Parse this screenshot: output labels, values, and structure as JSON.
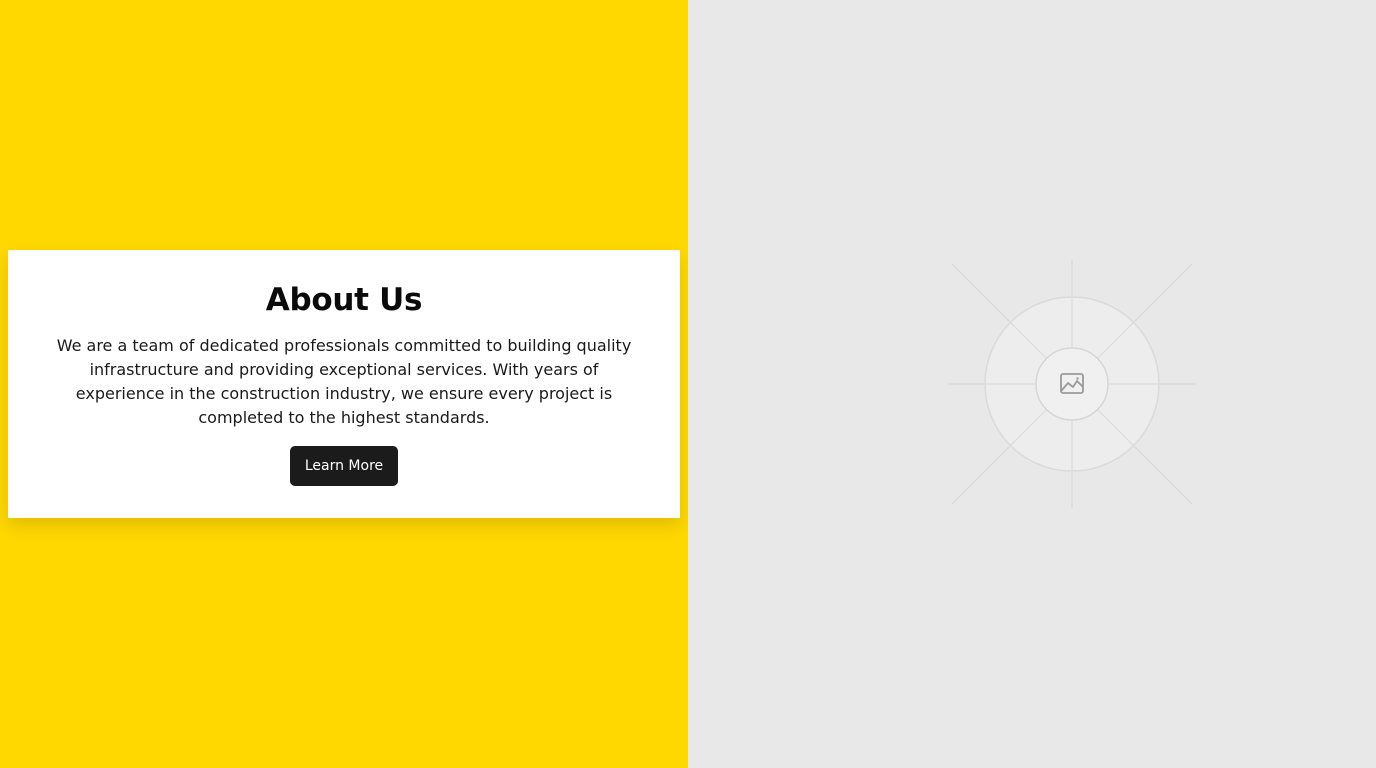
{
  "about": {
    "title": "About Us",
    "description": "We are a team of dedicated professionals committed to building quality infrastructure and providing exceptional services. With years of experience in the construction industry, we ensure every project is completed to the highest standards.",
    "button_label": "Learn More"
  },
  "colors": {
    "left_background": "#FFD800",
    "right_background": "#E8E8E8",
    "card_background": "#FFFFFF",
    "button_background": "#1B1B1B"
  },
  "image_placeholder": {
    "icon": "image-icon"
  }
}
